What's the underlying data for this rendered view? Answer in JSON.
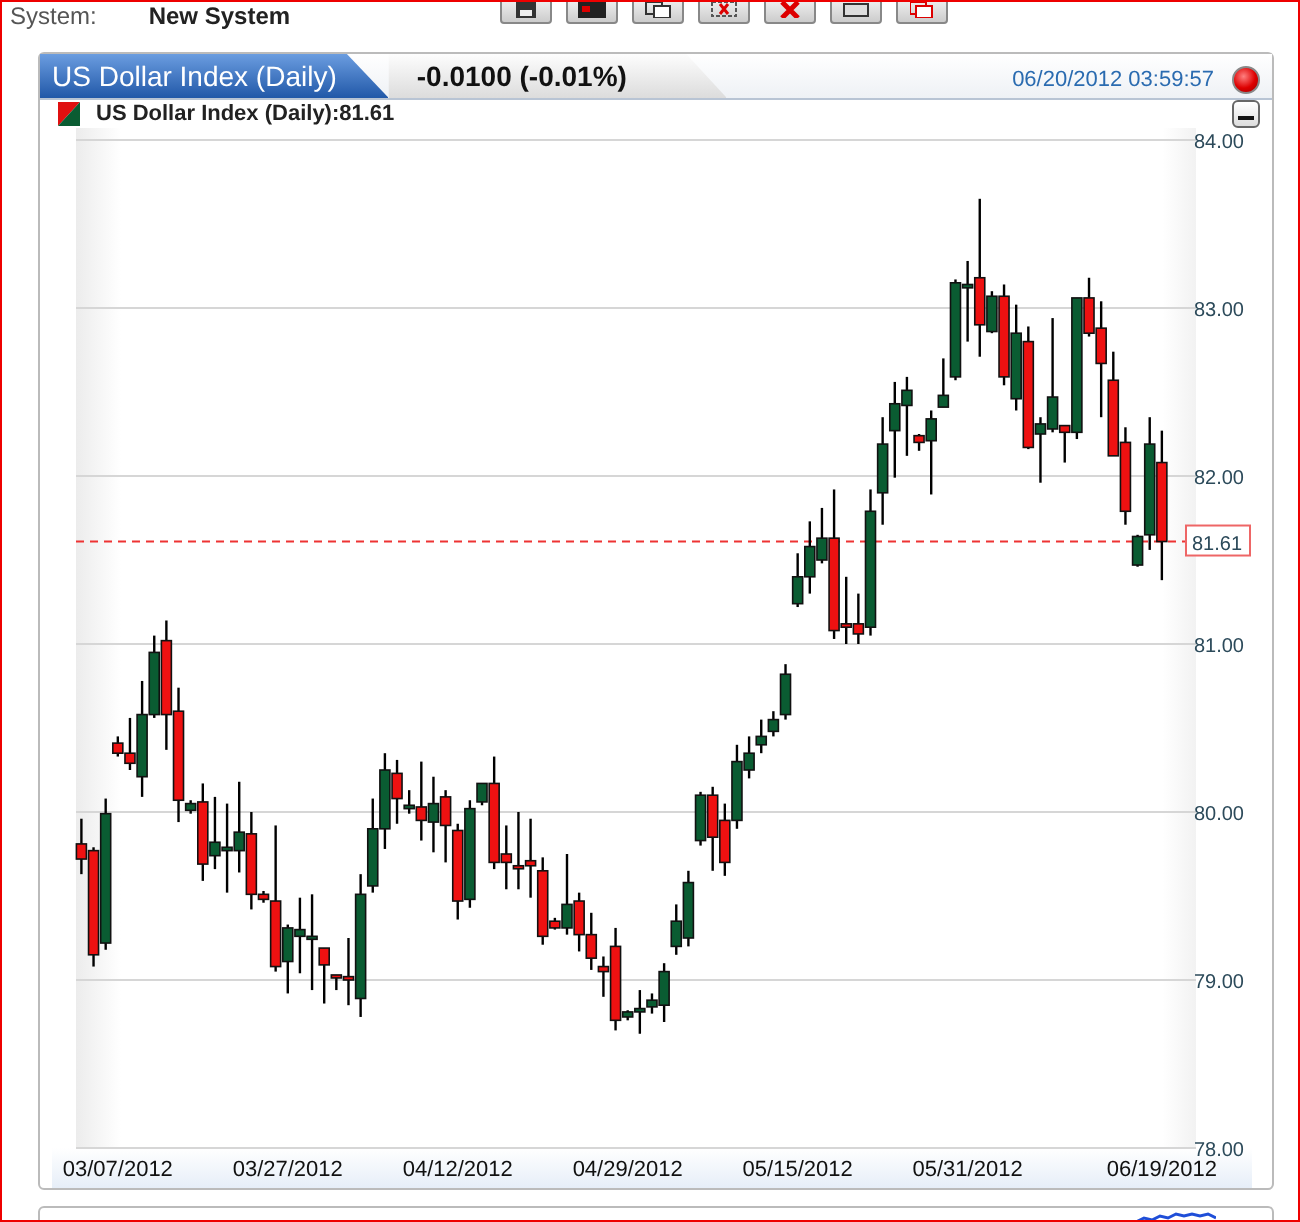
{
  "system_bar": {
    "label": "System:",
    "value": "New System"
  },
  "tabs": [
    {
      "label": "US Dollar Index (Daily)",
      "selected": true
    },
    {
      "label": "-0.0100 (-0.01%)",
      "selected": false
    }
  ],
  "timestamp": "06/20/2012 03:59:57",
  "chart_header": {
    "title": "US Dollar Index (Daily):81.61"
  },
  "chart_data": {
    "type": "candlestick",
    "categories": [
      null,
      null,
      null,
      "03/07/2012",
      null,
      null,
      null,
      null,
      null,
      null,
      null,
      null,
      null,
      null,
      null,
      null,
      null,
      "03/27/2012",
      null,
      null,
      null,
      null,
      null,
      null,
      null,
      null,
      null,
      null,
      null,
      null,
      null,
      "04/12/2012",
      null,
      null,
      null,
      null,
      null,
      null,
      null,
      null,
      null,
      null,
      null,
      null,
      null,
      "04/29/2012",
      null,
      null,
      null,
      null,
      null,
      null,
      null,
      null,
      null,
      null,
      null,
      null,
      null,
      "05/15/2012",
      null,
      null,
      null,
      null,
      null,
      null,
      null,
      null,
      null,
      null,
      null,
      null,
      null,
      "05/31/2012",
      null,
      null,
      null,
      null,
      null,
      null,
      null,
      null,
      null,
      null,
      null,
      null,
      null,
      null,
      null,
      "06/19/2012"
    ],
    "ohlc": [
      [
        79.81,
        79.96,
        79.63,
        79.72
      ],
      [
        79.77,
        79.79,
        79.08,
        79.15
      ],
      [
        79.22,
        80.08,
        79.18,
        79.99
      ],
      [
        80.41,
        80.45,
        80.33,
        80.35
      ],
      [
        80.35,
        80.56,
        80.25,
        80.29
      ],
      [
        80.21,
        80.78,
        80.09,
        80.58
      ],
      [
        80.58,
        81.05,
        80.56,
        80.95
      ],
      [
        81.02,
        81.14,
        80.37,
        80.58
      ],
      [
        80.6,
        80.74,
        79.94,
        80.07
      ],
      [
        80.01,
        80.07,
        79.99,
        80.05
      ],
      [
        80.06,
        80.17,
        79.59,
        79.69
      ],
      [
        79.74,
        80.09,
        79.66,
        79.82
      ],
      [
        79.77,
        80.05,
        79.52,
        79.79
      ],
      [
        79.77,
        80.18,
        79.64,
        79.88
      ],
      [
        79.87,
        80.0,
        79.42,
        79.51
      ],
      [
        79.51,
        79.53,
        79.46,
        79.48
      ],
      [
        79.47,
        79.92,
        79.05,
        79.08
      ],
      [
        79.11,
        79.33,
        78.92,
        79.31
      ],
      [
        79.26,
        79.49,
        79.04,
        79.3
      ],
      [
        79.25,
        79.51,
        78.94,
        79.26
      ],
      [
        79.19,
        79.19,
        78.86,
        79.09
      ],
      [
        79.03,
        79.03,
        78.94,
        79.02
      ],
      [
        79.02,
        79.25,
        78.85,
        79.0
      ],
      [
        78.89,
        79.63,
        78.78,
        79.51
      ],
      [
        79.56,
        80.08,
        79.52,
        79.9
      ],
      [
        79.9,
        80.35,
        79.78,
        80.25
      ],
      [
        80.23,
        80.31,
        79.93,
        80.08
      ],
      [
        80.02,
        80.13,
        79.99,
        80.04
      ],
      [
        80.03,
        80.3,
        79.83,
        79.95
      ],
      [
        79.94,
        80.21,
        79.76,
        80.05
      ],
      [
        80.09,
        80.13,
        79.7,
        79.92
      ],
      [
        79.89,
        79.93,
        79.36,
        79.47
      ],
      [
        79.48,
        80.07,
        79.43,
        80.02
      ],
      [
        80.06,
        80.17,
        80.04,
        80.17
      ],
      [
        80.17,
        80.33,
        79.66,
        79.7
      ],
      [
        79.75,
        79.92,
        79.54,
        79.7
      ],
      [
        79.68,
        80.0,
        79.54,
        79.67
      ],
      [
        79.71,
        79.96,
        79.49,
        79.68
      ],
      [
        79.65,
        79.73,
        79.21,
        79.26
      ],
      [
        79.35,
        79.37,
        79.3,
        79.31
      ],
      [
        79.31,
        79.75,
        79.27,
        79.45
      ],
      [
        79.47,
        79.52,
        79.17,
        79.27
      ],
      [
        79.27,
        79.4,
        79.06,
        79.13
      ],
      [
        79.08,
        79.14,
        78.9,
        79.05
      ],
      [
        79.2,
        79.31,
        78.7,
        78.76
      ],
      [
        78.78,
        78.82,
        78.76,
        78.81
      ],
      [
        78.81,
        78.94,
        78.68,
        78.83
      ],
      [
        78.84,
        78.92,
        78.8,
        78.88
      ],
      [
        78.85,
        79.1,
        78.75,
        79.05
      ],
      [
        79.2,
        79.45,
        79.15,
        79.35
      ],
      [
        79.25,
        79.65,
        79.2,
        79.58
      ],
      [
        79.83,
        80.12,
        79.8,
        80.1
      ],
      [
        80.1,
        80.15,
        79.65,
        79.85
      ],
      [
        79.95,
        80.05,
        79.62,
        79.7
      ],
      [
        79.95,
        80.4,
        79.9,
        80.3
      ],
      [
        80.25,
        80.45,
        80.2,
        80.35
      ],
      [
        80.4,
        80.55,
        80.35,
        80.45
      ],
      [
        80.48,
        80.6,
        80.45,
        80.55
      ],
      [
        80.58,
        80.88,
        80.55,
        80.82
      ],
      [
        81.24,
        81.54,
        81.22,
        81.4
      ],
      [
        81.4,
        81.73,
        81.3,
        81.58
      ],
      [
        81.5,
        81.81,
        81.48,
        81.63
      ],
      [
        81.63,
        81.92,
        81.03,
        81.08
      ],
      [
        81.12,
        81.4,
        81.0,
        81.1
      ],
      [
        81.12,
        81.3,
        81.0,
        81.06
      ],
      [
        81.1,
        81.92,
        81.05,
        81.79
      ],
      [
        81.9,
        82.35,
        81.71,
        82.19
      ],
      [
        82.27,
        82.56,
        81.99,
        82.43
      ],
      [
        82.42,
        82.59,
        82.12,
        82.51
      ],
      [
        82.24,
        82.25,
        82.15,
        82.2
      ],
      [
        82.21,
        82.39,
        81.89,
        82.34
      ],
      [
        82.41,
        82.7,
        82.41,
        82.48
      ],
      [
        82.59,
        83.17,
        82.57,
        83.15
      ],
      [
        83.12,
        83.28,
        82.8,
        83.14
      ],
      [
        83.18,
        83.65,
        82.71,
        82.9
      ],
      [
        82.86,
        83.1,
        82.85,
        83.07
      ],
      [
        83.07,
        83.14,
        82.54,
        82.59
      ],
      [
        82.46,
        83.02,
        82.39,
        82.85
      ],
      [
        82.8,
        82.89,
        82.16,
        82.17
      ],
      [
        82.25,
        82.35,
        81.96,
        82.31
      ],
      [
        82.28,
        82.94,
        82.26,
        82.47
      ],
      [
        82.3,
        82.3,
        82.08,
        82.26
      ],
      [
        82.26,
        83.06,
        82.22,
        83.06
      ],
      [
        83.06,
        83.18,
        82.83,
        82.85
      ],
      [
        82.88,
        83.04,
        82.35,
        82.67
      ],
      [
        82.57,
        82.74,
        82.12,
        82.12
      ],
      [
        82.2,
        82.29,
        81.71,
        81.79
      ],
      [
        81.47,
        81.65,
        81.46,
        81.64
      ],
      [
        81.65,
        82.35,
        81.56,
        82.19
      ],
      [
        82.08,
        82.27,
        81.38,
        81.61
      ]
    ],
    "ylim": [
      78,
      84
    ],
    "grid": true,
    "ref_lines": [
      {
        "axis": "y",
        "value": 81.61,
        "label": "81.61"
      }
    ],
    "yticks": [
      {
        "value": 84,
        "label": "84.00"
      },
      {
        "value": 83,
        "label": "83.00"
      },
      {
        "value": 82,
        "label": "82.00"
      },
      {
        "value": 81,
        "label": "81.00"
      },
      {
        "value": 80,
        "label": "80.00"
      },
      {
        "value": 79,
        "label": "79.00"
      },
      {
        "value": 78,
        "label": "78.00"
      }
    ]
  }
}
